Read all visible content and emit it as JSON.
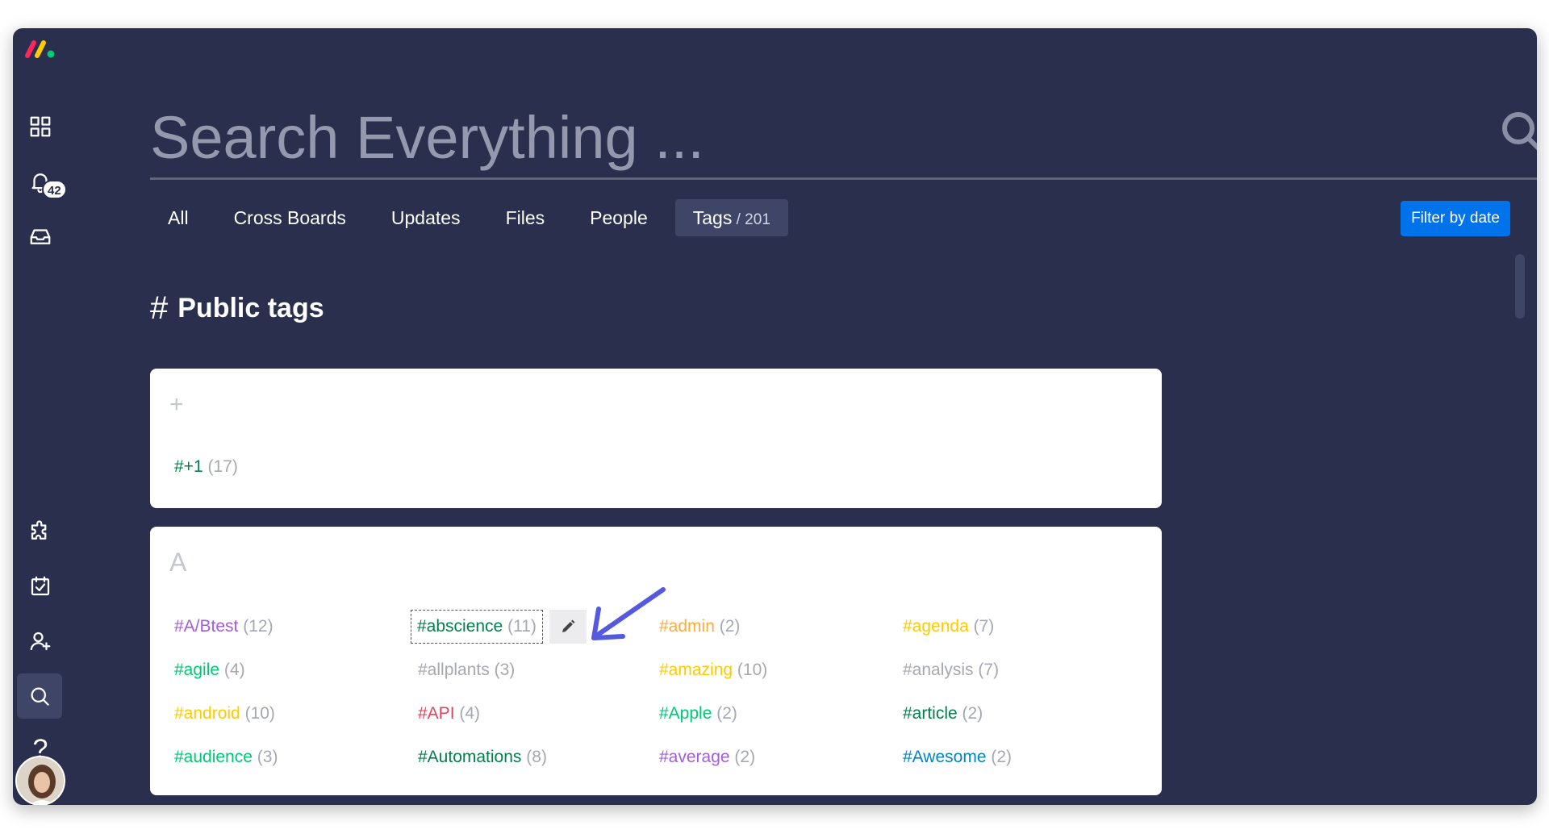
{
  "sidebar": {
    "inbox_badge": "42",
    "help_label": "?"
  },
  "search": {
    "placeholder": "Search Everything ..."
  },
  "tabs": [
    {
      "label": "All",
      "count": ""
    },
    {
      "label": "Cross Boards",
      "count": ""
    },
    {
      "label": "Updates",
      "count": ""
    },
    {
      "label": "Files",
      "count": ""
    },
    {
      "label": "People",
      "count": ""
    },
    {
      "label": "Tags",
      "count": " / 201"
    }
  ],
  "filter_button": "Filter by date",
  "section": {
    "title": "Public tags",
    "hash": "#"
  },
  "groups": {
    "plus": {
      "letter": "+",
      "tags": [
        {
          "name": "#+1",
          "count": "(17)",
          "color": "#037f4c"
        }
      ]
    },
    "a": {
      "letter": "A",
      "tags": [
        {
          "name": "#A/Btest",
          "count": "(12)",
          "color": "#a25ddc"
        },
        {
          "name": "#abscience",
          "count": "(11)",
          "color": "#037f4c"
        },
        {
          "name": "#admin",
          "count": "(2)",
          "color": "#fdab3d"
        },
        {
          "name": "#agenda",
          "count": "(7)",
          "color": "#ffcb00"
        },
        {
          "name": "#agile",
          "count": "(4)",
          "color": "#00c875"
        },
        {
          "name": "#allplants",
          "count": "(3)",
          "color": "#a5a7b3"
        },
        {
          "name": "#amazing",
          "count": "(10)",
          "color": "#ffcb00"
        },
        {
          "name": "#analysis",
          "count": "(7)",
          "color": "#a5a7b3"
        },
        {
          "name": "#android",
          "count": "(10)",
          "color": "#ffcb00"
        },
        {
          "name": "#API",
          "count": "(4)",
          "color": "#e2445c"
        },
        {
          "name": "#Apple",
          "count": "(2)",
          "color": "#00c875"
        },
        {
          "name": "#article",
          "count": "(2)",
          "color": "#037f4c"
        },
        {
          "name": "#audience",
          "count": "(3)",
          "color": "#00c875"
        },
        {
          "name": "#Automations",
          "count": "(8)",
          "color": "#037f4c"
        },
        {
          "name": "#average",
          "count": "(2)",
          "color": "#a25ddc"
        },
        {
          "name": "#Awesome",
          "count": "(2)",
          "color": "#0086c0"
        }
      ]
    }
  },
  "colors": {
    "background": "#292f4c",
    "accent": "#0073ea",
    "arrow": "#5559df"
  }
}
